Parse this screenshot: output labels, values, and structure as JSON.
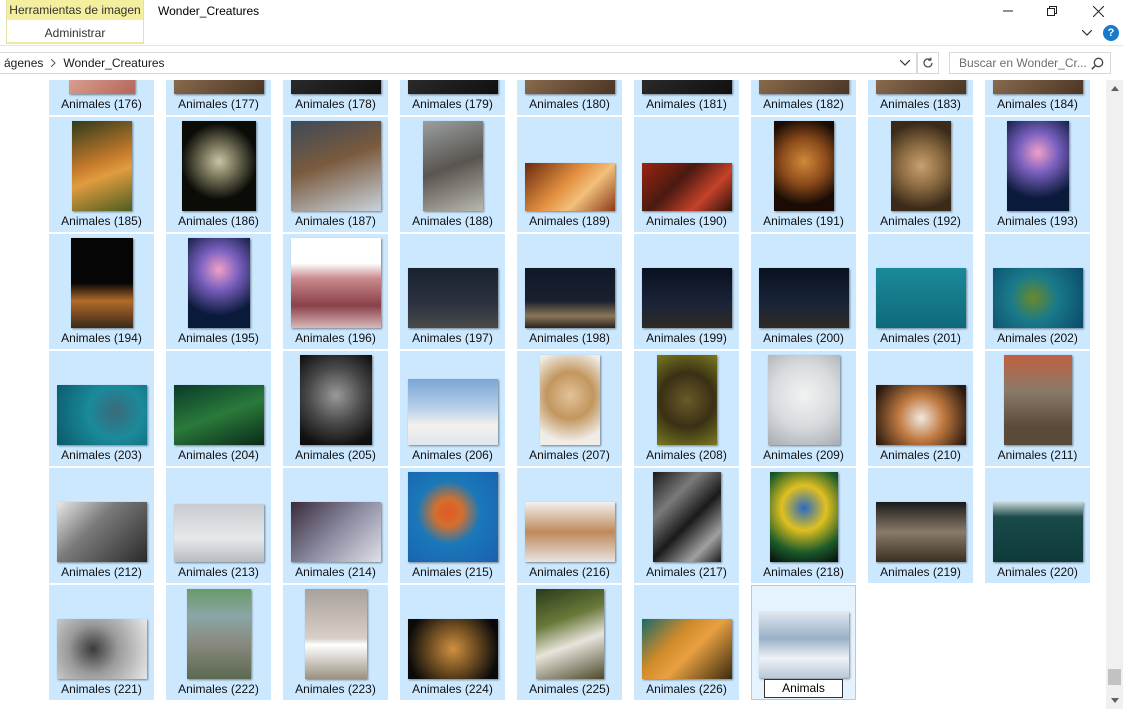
{
  "window": {
    "title": "Wonder_Creatures",
    "tool_tab_header": "Herramientas de imagen",
    "tool_tab_sub": "Administrar",
    "help_label": "?"
  },
  "address": {
    "crumbs": [
      "ágenes",
      "Wonder_Creatures"
    ],
    "search_placeholder": "Buscar en Wonder_Cr..."
  },
  "colors": {
    "selection_bg": "#cce8ff",
    "focused_bg": "#e5f3ff",
    "ribbon_tab": "#f4ee9f",
    "help_blue": "#1979ca"
  },
  "tiles": [
    {
      "label": "Animales (176)",
      "icon": "pink-animal-photo"
    },
    {
      "label": "Animales (177)",
      "icon": "animal-photo"
    },
    {
      "label": "Animales (178)",
      "icon": "dark-animal-photo"
    },
    {
      "label": "Animales (179)",
      "icon": "dark-animal-photo"
    },
    {
      "label": "Animales (180)",
      "icon": "animal-photo"
    },
    {
      "label": "Animales (181)",
      "icon": "dark-animal-photo"
    },
    {
      "label": "Animales (182)",
      "icon": "animal-photo"
    },
    {
      "label": "Animales (183)",
      "icon": "animal-photo"
    },
    {
      "label": "Animales (184)",
      "icon": "animal-photo"
    },
    {
      "label": "Animales (185)",
      "icon": "tigers-photo"
    },
    {
      "label": "Animales (186)",
      "icon": "owl-photo"
    },
    {
      "label": "Animales (187)",
      "icon": "bear-photo"
    },
    {
      "label": "Animales (188)",
      "icon": "snow-leopard-photo"
    },
    {
      "label": "Animales (189)",
      "icon": "coral-photo"
    },
    {
      "label": "Animales (190)",
      "icon": "fish-photo"
    },
    {
      "label": "Animales (191)",
      "icon": "lion-photo"
    },
    {
      "label": "Animales (192)",
      "icon": "cheetah-photo"
    },
    {
      "label": "Animales (193)",
      "icon": "jellyfish-photo"
    },
    {
      "label": "Animales (194)",
      "icon": "lion-cub-photo"
    },
    {
      "label": "Animales (195)",
      "icon": "jellyfish-photo"
    },
    {
      "label": "Animales (196)",
      "icon": "meme-photo"
    },
    {
      "label": "Animales (197)",
      "icon": "hyena-night-photo"
    },
    {
      "label": "Animales (198)",
      "icon": "lion-night-photo"
    },
    {
      "label": "Animales (199)",
      "icon": "night-sky-photo"
    },
    {
      "label": "Animales (200)",
      "icon": "night-sky-photo"
    },
    {
      "label": "Animales (201)",
      "icon": "ocean-photo"
    },
    {
      "label": "Animales (202)",
      "icon": "turtle-photo"
    },
    {
      "label": "Animales (203)",
      "icon": "fish-school-photo"
    },
    {
      "label": "Animales (204)",
      "icon": "kelp-forest-photo"
    },
    {
      "label": "Animales (205)",
      "icon": "elephant-photo"
    },
    {
      "label": "Animales (206)",
      "icon": "arctic-hare-photo"
    },
    {
      "label": "Animales (207)",
      "icon": "fennec-fox-photo"
    },
    {
      "label": "Animales (208)",
      "icon": "porcupine-photo"
    },
    {
      "label": "Animales (209)",
      "icon": "arctic-fox-photo"
    },
    {
      "label": "Animales (210)",
      "icon": "tiger-roar-photo"
    },
    {
      "label": "Animales (211)",
      "icon": "tortoise-photo"
    },
    {
      "label": "Animales (212)",
      "icon": "wolves-photo"
    },
    {
      "label": "Animales (213)",
      "icon": "wolf-pack-photo"
    },
    {
      "label": "Animales (214)",
      "icon": "cat-photo"
    },
    {
      "label": "Animales (215)",
      "icon": "map-photo"
    },
    {
      "label": "Animales (216)",
      "icon": "lioness-photo"
    },
    {
      "label": "Animales (217)",
      "icon": "starfish-photo"
    },
    {
      "label": "Animales (218)",
      "icon": "macaw-photo"
    },
    {
      "label": "Animales (219)",
      "icon": "sloth-photo"
    },
    {
      "label": "Animales (220)",
      "icon": "underwater-bear-photo"
    },
    {
      "label": "Animales (221)",
      "icon": "lion-bw-photo"
    },
    {
      "label": "Animales (222)",
      "icon": "dam-photo"
    },
    {
      "label": "Animales (223)",
      "icon": "tower-photo"
    },
    {
      "label": "Animales (224)",
      "icon": "jaguar-photo"
    },
    {
      "label": "Animales (225)",
      "icon": "white-wolf-photo"
    },
    {
      "label": "Animales (226)",
      "icon": "tiger-fight-photo"
    }
  ],
  "editing_tile": {
    "label": "Animals",
    "icon": "snow-ice-photo"
  }
}
